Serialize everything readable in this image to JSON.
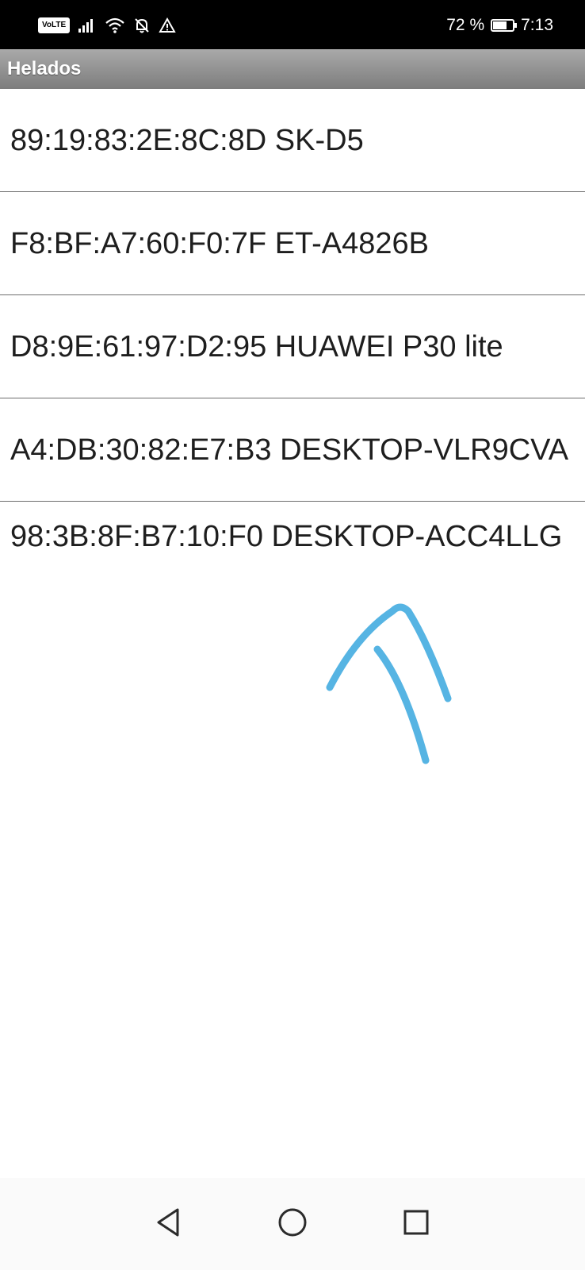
{
  "status_bar": {
    "network_badge": "VoLTE",
    "battery_percent": "72 %",
    "battery_level": 0.72,
    "time": "7:13",
    "icons": [
      "volte-icon",
      "signal-icon",
      "wifi-icon",
      "notifications-off-icon",
      "warning-icon",
      "battery-icon"
    ]
  },
  "app_bar": {
    "title": "Helados"
  },
  "devices": [
    {
      "address": "89:19:83:2E:8C:8D",
      "name": "SK-D5",
      "label": "89:19:83:2E:8C:8D SK-D5"
    },
    {
      "address": "F8:BF:A7:60:F0:7F",
      "name": "ET-A4826B",
      "label": "F8:BF:A7:60:F0:7F ET-A4826B"
    },
    {
      "address": "D8:9E:61:97:D2:95",
      "name": "HUAWEI P30 lite",
      "label": "D8:9E:61:97:D2:95 HUAWEI P30 lite"
    },
    {
      "address": "A4:DB:30:82:E7:B3",
      "name": "DESKTOP-VLR9CVA",
      "label": "A4:DB:30:82:E7:B3 DESKTOP-VLR9CVA"
    },
    {
      "address": "98:3B:8F:B7:10:F0",
      "name": "DESKTOP-ACC4LLG",
      "label": "98:3B:8F:B7:10:F0 DESKTOP-ACC4LLG"
    }
  ],
  "annotation": {
    "type": "hand-drawn-arrow",
    "color": "#56b4e3"
  },
  "nav_bar": {
    "buttons": [
      "back-icon",
      "home-icon",
      "recents-icon"
    ]
  }
}
